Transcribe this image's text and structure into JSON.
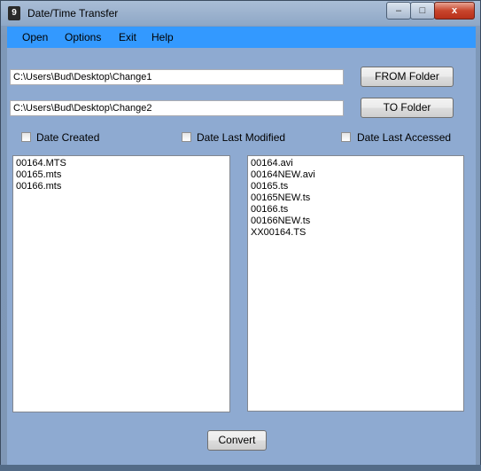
{
  "window": {
    "title": "Date/Time Transfer",
    "icon": "app-icon",
    "icon_glyph": "9",
    "controls": {
      "minimize": "–",
      "maximize": "□",
      "close": "x"
    }
  },
  "menu": {
    "items": [
      "Open",
      "Options",
      "Exit",
      "Help"
    ]
  },
  "paths": {
    "from_value": "C:\\Users\\Bud\\Desktop\\Change1",
    "to_value": "C:\\Users\\Bud\\Desktop\\Change2"
  },
  "buttons": {
    "from_folder": "FROM Folder",
    "to_folder": "TO Folder",
    "convert": "Convert"
  },
  "checkboxes": [
    {
      "label": "Date Created",
      "checked": false
    },
    {
      "label": "Date Last Modified",
      "checked": false
    },
    {
      "label": "Date Last Accessed",
      "checked": false
    }
  ],
  "lists": {
    "from_files": [
      "00164.MTS",
      "00165.mts",
      "00166.mts"
    ],
    "to_files": [
      "00164.avi",
      "00164NEW.avi",
      "00165.ts",
      "00165NEW.ts",
      "00166.ts",
      "00166NEW.ts",
      "XX00164.TS"
    ]
  },
  "colors": {
    "menubar": "#3399ff",
    "client_bg": "#8eaad1",
    "close_button": "#c8452c"
  }
}
